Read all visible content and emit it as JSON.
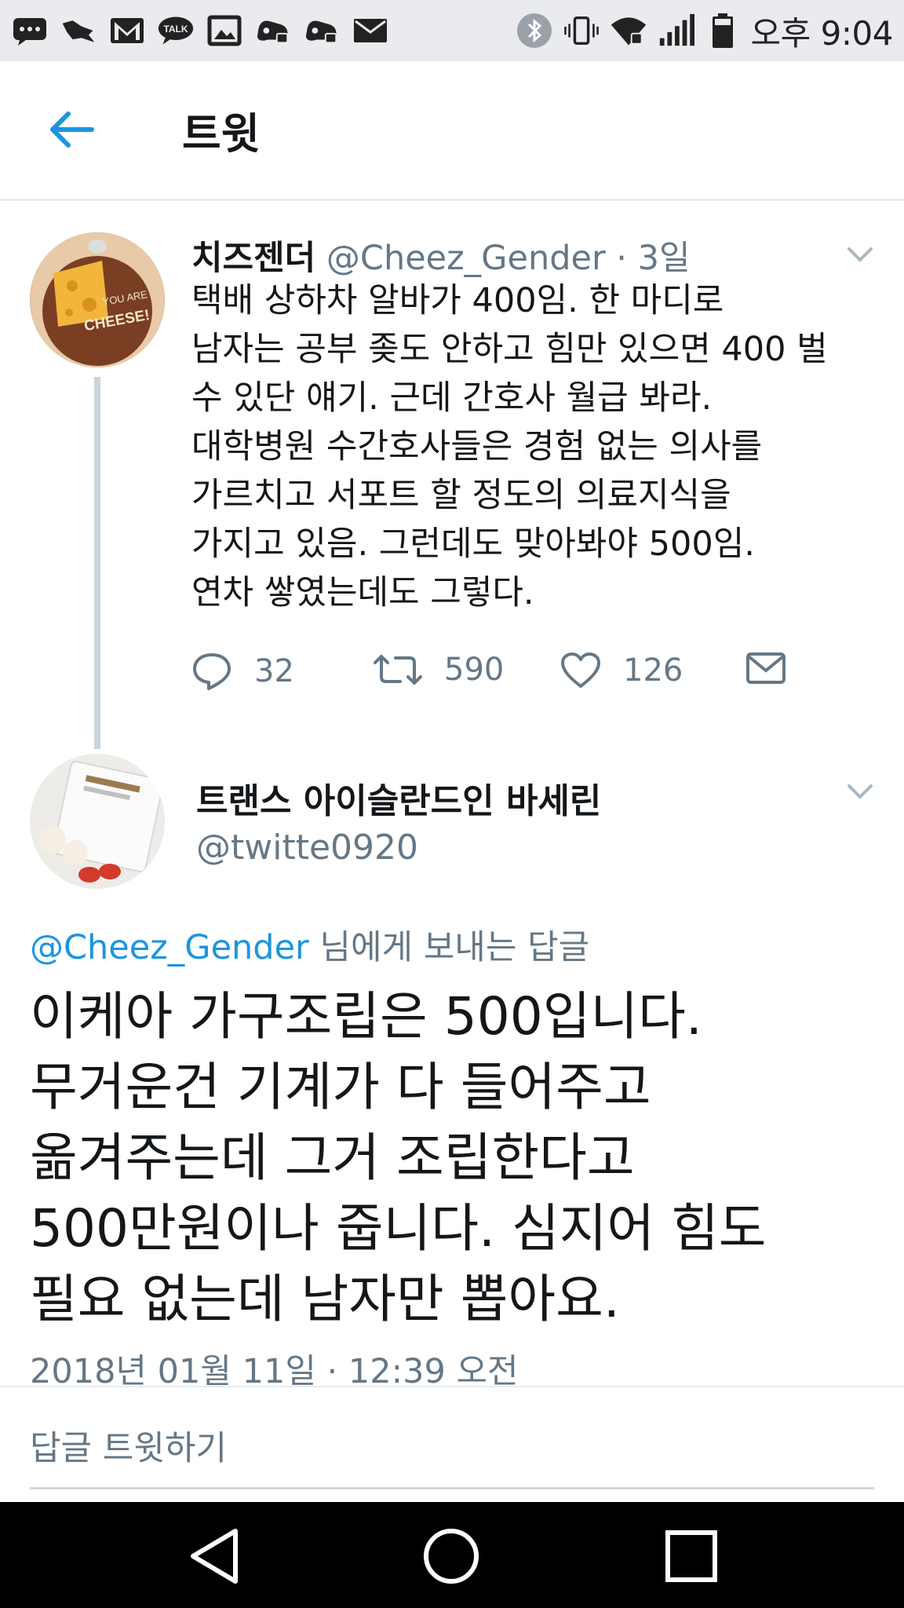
{
  "status_bar": {
    "icons_left": [
      "chat-bubble-icon",
      "bird-icon",
      "gmail-icon",
      "kakaotalk-icon",
      "gallery-icon",
      "game-controller-icon",
      "game-controller-icon",
      "mail-icon"
    ],
    "kakaotalk_label": "TALK",
    "icons_right": [
      "bluetooth-icon",
      "vibrate-icon",
      "wifi-icon",
      "signal-icon",
      "battery-icon"
    ],
    "time": "오후 9:04"
  },
  "header": {
    "title": "트윗"
  },
  "parent_tweet": {
    "display_name": "치즈젠더",
    "handle": "@Cheez_Gender",
    "time_ago": " · 3일",
    "avatar_text": [
      "YOU ARE",
      "CHEESE!"
    ],
    "text": "택배 상하차 알바가 400임. 한 마디로\n남자는 공부 좆도 안하고 힘만 있으면 400 벌\n수 있단 얘기. 근데 간호사 월급 봐라.\n대학병원 수간호사들은 경험 없는 의사를\n가르치고 서포트 할 정도의 의료지식을\n가지고 있음. 그런데도 맞아봐야 500임.\n연차 쌓였는데도 그렇다.",
    "reply_count": "32",
    "retweet_count": "590",
    "like_count": "126"
  },
  "main_tweet": {
    "display_name": "트랜스 아이슬란드인 바세린",
    "handle": "@twitte0920",
    "reply_to_mention": "@Cheez_Gender",
    "reply_to_suffix": " 님에게 보내는 답글",
    "text": "이케아 가구조립은 500입니다.\n무거운건 기계가 다 들어주고\n옮겨주는데 그거 조립한다고\n500만원이나 줍니다. 심지어 힘도\n필요 없는데 남자만 뽑아요.",
    "timestamp": "2018년 01월 11일 · 12:39 오전"
  },
  "reply_box": {
    "placeholder": "답글 트윗하기"
  },
  "colors": {
    "accent": "#1b95e0",
    "muted": "#657786",
    "text": "#14171a"
  }
}
